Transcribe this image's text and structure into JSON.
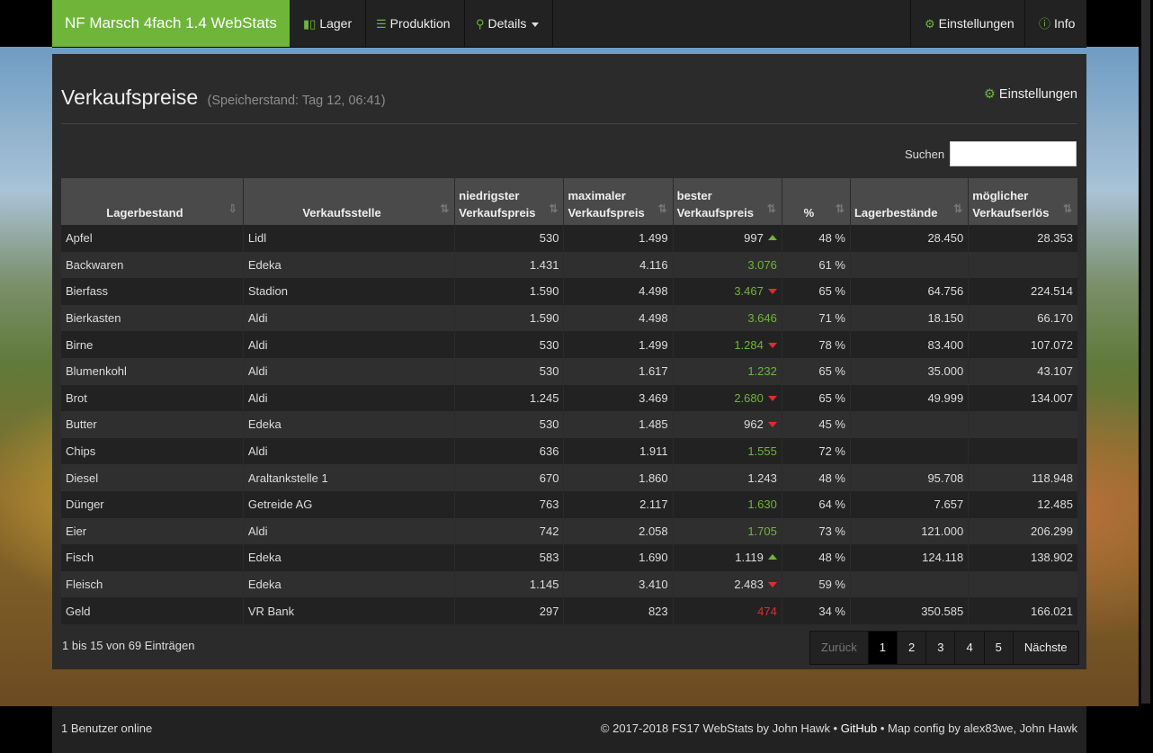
{
  "navbar": {
    "brand": "NF Marsch 4fach 1.4 WebStats",
    "items": [
      {
        "label": "Lager",
        "icon": "bar-chart-icon"
      },
      {
        "label": "Produktion",
        "icon": "list-icon"
      },
      {
        "label": "Details",
        "icon": "search-icon"
      }
    ],
    "right_items": [
      {
        "label": "Einstellungen",
        "icon": "gear-icon"
      },
      {
        "label": "Info",
        "icon": "info-icon"
      }
    ]
  },
  "page": {
    "title": "Verkaufspreise",
    "subtitle": "(Speicherstand: Tag 12, 06:41)",
    "settings_label": "Einstellungen"
  },
  "search": {
    "label": "Suchen",
    "value": ""
  },
  "table": {
    "columns": [
      "Lagerbestand",
      "Verkaufsstelle",
      "niedrigster Verkaufspreis",
      "maximaler Verkaufspreis",
      "bester Verkaufspreis",
      "%",
      "Lagerbestände",
      "möglicher Verkaufserlös"
    ],
    "rows": [
      {
        "name": "Apfel",
        "stelle": "Lidl",
        "min": "530",
        "max": "1.499",
        "best": "997",
        "best_color": "default",
        "trend": "up",
        "pct": "48 %",
        "lager": "28.450",
        "erloes": "28.353"
      },
      {
        "name": "Backwaren",
        "stelle": "Edeka",
        "min": "1.431",
        "max": "4.116",
        "best": "3.076",
        "best_color": "green",
        "trend": "",
        "pct": "61 %",
        "lager": "",
        "erloes": ""
      },
      {
        "name": "Bierfass",
        "stelle": "Stadion",
        "min": "1.590",
        "max": "4.498",
        "best": "3.467",
        "best_color": "green",
        "trend": "down",
        "pct": "65 %",
        "lager": "64.756",
        "erloes": "224.514"
      },
      {
        "name": "Bierkasten",
        "stelle": "Aldi",
        "min": "1.590",
        "max": "4.498",
        "best": "3.646",
        "best_color": "green",
        "trend": "",
        "pct": "71 %",
        "lager": "18.150",
        "erloes": "66.170"
      },
      {
        "name": "Birne",
        "stelle": "Aldi",
        "min": "530",
        "max": "1.499",
        "best": "1.284",
        "best_color": "green",
        "trend": "down",
        "pct": "78 %",
        "lager": "83.400",
        "erloes": "107.072"
      },
      {
        "name": "Blumenkohl",
        "stelle": "Aldi",
        "min": "530",
        "max": "1.617",
        "best": "1.232",
        "best_color": "green",
        "trend": "",
        "pct": "65 %",
        "lager": "35.000",
        "erloes": "43.107"
      },
      {
        "name": "Brot",
        "stelle": "Aldi",
        "min": "1.245",
        "max": "3.469",
        "best": "2.680",
        "best_color": "green",
        "trend": "down",
        "pct": "65 %",
        "lager": "49.999",
        "erloes": "134.007"
      },
      {
        "name": "Butter",
        "stelle": "Edeka",
        "min": "530",
        "max": "1.485",
        "best": "962",
        "best_color": "default",
        "trend": "down",
        "pct": "45 %",
        "lager": "",
        "erloes": ""
      },
      {
        "name": "Chips",
        "stelle": "Aldi",
        "min": "636",
        "max": "1.911",
        "best": "1.555",
        "best_color": "green",
        "trend": "",
        "pct": "72 %",
        "lager": "",
        "erloes": ""
      },
      {
        "name": "Diesel",
        "stelle": "Araltankstelle 1",
        "min": "670",
        "max": "1.860",
        "best": "1.243",
        "best_color": "default",
        "trend": "",
        "pct": "48 %",
        "lager": "95.708",
        "erloes": "118.948"
      },
      {
        "name": "Dünger",
        "stelle": "Getreide AG",
        "min": "763",
        "max": "2.117",
        "best": "1.630",
        "best_color": "green",
        "trend": "",
        "pct": "64 %",
        "lager": "7.657",
        "erloes": "12.485"
      },
      {
        "name": "Eier",
        "stelle": "Aldi",
        "min": "742",
        "max": "2.058",
        "best": "1.705",
        "best_color": "green",
        "trend": "",
        "pct": "73 %",
        "lager": "121.000",
        "erloes": "206.299"
      },
      {
        "name": "Fisch",
        "stelle": "Edeka",
        "min": "583",
        "max": "1.690",
        "best": "1.119",
        "best_color": "default",
        "trend": "up",
        "pct": "48 %",
        "lager": "124.118",
        "erloes": "138.902"
      },
      {
        "name": "Fleisch",
        "stelle": "Edeka",
        "min": "1.145",
        "max": "3.410",
        "best": "2.483",
        "best_color": "default",
        "trend": "down",
        "pct": "59 %",
        "lager": "",
        "erloes": ""
      },
      {
        "name": "Geld",
        "stelle": "VR Bank",
        "min": "297",
        "max": "823",
        "best": "474",
        "best_color": "red",
        "trend": "",
        "pct": "34 %",
        "lager": "350.585",
        "erloes": "166.021"
      }
    ]
  },
  "pagination": {
    "info": "1 bis 15 von 69 Einträgen",
    "prev": "Zurück",
    "pages": [
      "1",
      "2",
      "3",
      "4",
      "5"
    ],
    "active": "1",
    "next": "Nächste"
  },
  "footer": {
    "left": "1 Benutzer online",
    "copyright": "© 2017-2018 FS17 WebStats by John Hawk •",
    "github": "GitHub",
    "mapconfig": "• Map config by alex83we, John Hawk"
  },
  "colors": {
    "accent": "#6fb53a",
    "down": "#d9302e",
    "panel": "#2b2b2b"
  }
}
